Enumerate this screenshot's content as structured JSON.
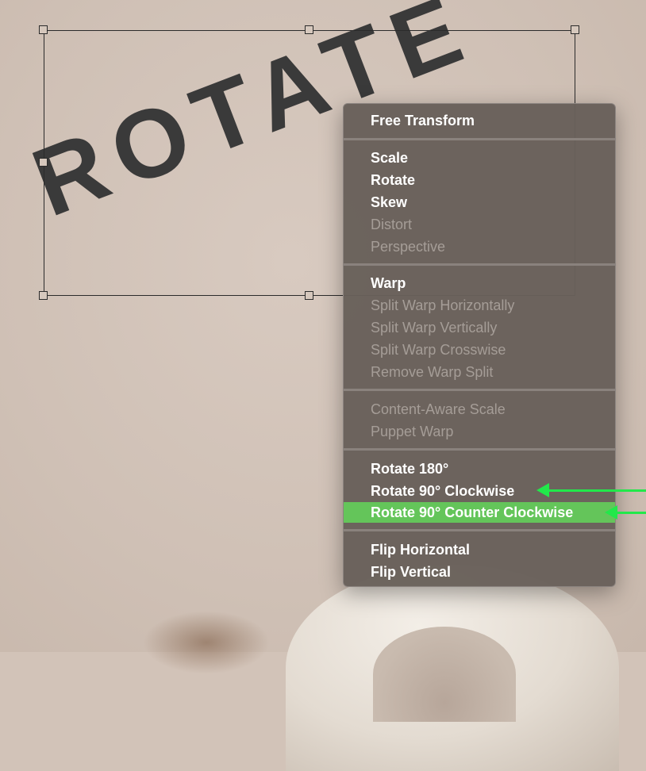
{
  "canvas": {
    "word": "ROTATE"
  },
  "menu": {
    "groups": [
      {
        "items": [
          {
            "label": "Free Transform",
            "enabled": true
          }
        ]
      },
      {
        "items": [
          {
            "label": "Scale",
            "enabled": true
          },
          {
            "label": "Rotate",
            "enabled": true
          },
          {
            "label": "Skew",
            "enabled": true
          },
          {
            "label": "Distort",
            "enabled": false
          },
          {
            "label": "Perspective",
            "enabled": false
          }
        ]
      },
      {
        "items": [
          {
            "label": "Warp",
            "enabled": true
          },
          {
            "label": "Split Warp Horizontally",
            "enabled": false
          },
          {
            "label": "Split Warp Vertically",
            "enabled": false
          },
          {
            "label": "Split Warp Crosswise",
            "enabled": false
          },
          {
            "label": "Remove Warp Split",
            "enabled": false
          }
        ]
      },
      {
        "items": [
          {
            "label": "Content-Aware Scale",
            "enabled": false
          },
          {
            "label": "Puppet Warp",
            "enabled": false
          }
        ]
      },
      {
        "items": [
          {
            "label": "Rotate 180°",
            "enabled": true
          },
          {
            "label": "Rotate 90° Clockwise",
            "enabled": true
          },
          {
            "label": "Rotate 90° Counter Clockwise",
            "enabled": true,
            "highlighted": true
          }
        ]
      },
      {
        "items": [
          {
            "label": "Flip Horizontal",
            "enabled": true
          },
          {
            "label": "Flip Vertical",
            "enabled": true
          }
        ]
      }
    ]
  },
  "annotations": {
    "arrow_color": "#22e84a",
    "highlight_color": "#64c55a"
  }
}
